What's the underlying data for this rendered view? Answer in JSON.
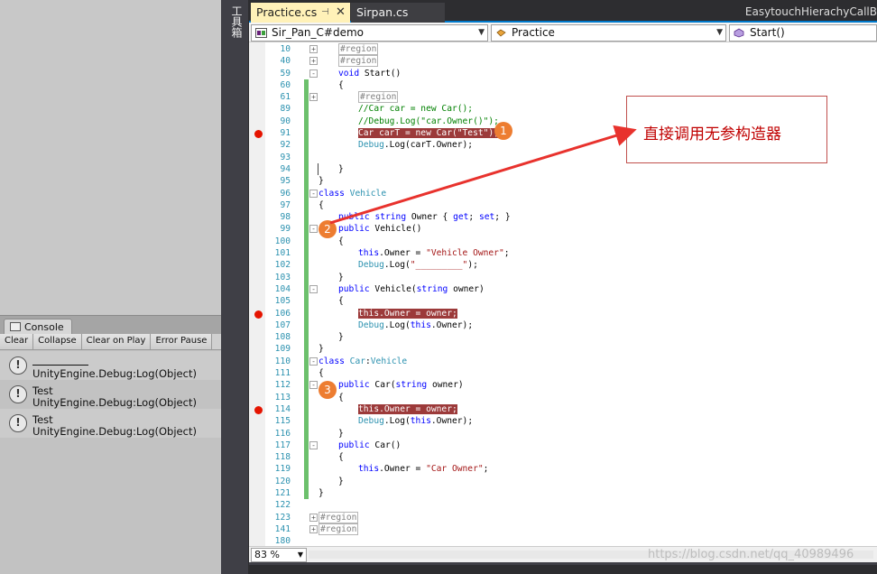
{
  "unity": {
    "console": {
      "tab_label": "Console",
      "toolbar": [
        "Clear",
        "Collapse",
        "Clear on Play",
        "Error Pause"
      ],
      "logs": [
        {
          "message": "",
          "source": "UnityEngine.Debug:Log(Object)",
          "underline": true
        },
        {
          "message": "Test",
          "source": "UnityEngine.Debug:Log(Object)",
          "underline": false
        },
        {
          "message": "Test",
          "source": "UnityEngine.Debug:Log(Object)",
          "underline": false
        }
      ]
    }
  },
  "toolbox": {
    "label": "工具箱"
  },
  "tabs": {
    "active": {
      "label": "Practice.cs",
      "pin": "⊣",
      "close": "✕"
    },
    "other": {
      "label": "Sirpan.cs"
    }
  },
  "window_title": "EasytouchHierachyCallB",
  "navbar": {
    "project": "Sir_Pan_C#demo",
    "class": "Practice",
    "method": "Start()"
  },
  "code": [
    {
      "n": "10",
      "indent": 2,
      "fold": "+",
      "chg": false,
      "tokens": [
        [
          "rg",
          "#region"
        ]
      ]
    },
    {
      "n": "40",
      "indent": 2,
      "fold": "+",
      "chg": false,
      "tokens": [
        [
          "rg",
          "#region"
        ]
      ]
    },
    {
      "n": "59",
      "indent": 2,
      "fold": "-",
      "chg": false,
      "tokens": [
        [
          "kw",
          "void"
        ],
        [
          "",
          " Start()"
        ]
      ]
    },
    {
      "n": "60",
      "indent": 2,
      "fold": "",
      "chg": true,
      "tokens": [
        [
          "",
          "{"
        ]
      ]
    },
    {
      "n": "61",
      "indent": 4,
      "fold": "+",
      "chg": true,
      "tokens": [
        [
          "rg",
          "#region"
        ]
      ]
    },
    {
      "n": "89",
      "indent": 4,
      "fold": "",
      "chg": true,
      "tokens": [
        [
          "cm",
          "//Car car = new Car();"
        ]
      ]
    },
    {
      "n": "90",
      "indent": 4,
      "fold": "",
      "chg": true,
      "tokens": [
        [
          "cm",
          "//Debug.Log(\"car.Owner()\");"
        ]
      ]
    },
    {
      "n": "91",
      "indent": 4,
      "fold": "",
      "chg": true,
      "bp": true,
      "tokens": [
        [
          "hl",
          "Car carT = new Car(\"Test\");"
        ]
      ]
    },
    {
      "n": "92",
      "indent": 4,
      "fold": "",
      "chg": true,
      "tokens": [
        [
          "ty",
          "Debug"
        ],
        [
          "",
          ".Log(carT.Owner);"
        ]
      ]
    },
    {
      "n": "93",
      "indent": 4,
      "fold": "",
      "chg": true,
      "tokens": []
    },
    {
      "n": "94",
      "indent": 2,
      "fold": "",
      "chg": true,
      "cursor": true,
      "tokens": [
        [
          "",
          "}"
        ]
      ]
    },
    {
      "n": "95",
      "indent": 0,
      "fold": "",
      "chg": true,
      "tokens": [
        [
          "",
          "}"
        ]
      ]
    },
    {
      "n": "96",
      "indent": 0,
      "fold": "-",
      "chg": true,
      "tokens": [
        [
          "kw",
          "class"
        ],
        [
          "",
          " "
        ],
        [
          "ty",
          "Vehicle"
        ]
      ]
    },
    {
      "n": "97",
      "indent": 0,
      "fold": "",
      "chg": true,
      "tokens": [
        [
          "",
          "{"
        ]
      ]
    },
    {
      "n": "98",
      "indent": 2,
      "fold": "",
      "chg": true,
      "tokens": [
        [
          "kw",
          "public"
        ],
        [
          "",
          " "
        ],
        [
          "kw",
          "string"
        ],
        [
          "",
          " Owner { "
        ],
        [
          "kw",
          "get"
        ],
        [
          "",
          "; "
        ],
        [
          "kw",
          "set"
        ],
        [
          "",
          "; }"
        ]
      ]
    },
    {
      "n": "99",
      "indent": 2,
      "fold": "-",
      "chg": true,
      "tokens": [
        [
          "kw",
          "public"
        ],
        [
          "",
          " Vehicle()"
        ]
      ]
    },
    {
      "n": "100",
      "indent": 2,
      "fold": "",
      "chg": true,
      "tokens": [
        [
          "",
          "{"
        ]
      ]
    },
    {
      "n": "101",
      "indent": 4,
      "fold": "",
      "chg": true,
      "tokens": [
        [
          "kw",
          "this"
        ],
        [
          "",
          ".Owner = "
        ],
        [
          "st",
          "\"Vehicle Owner\""
        ],
        [
          "",
          ";"
        ]
      ]
    },
    {
      "n": "102",
      "indent": 4,
      "fold": "",
      "chg": true,
      "tokens": [
        [
          "ty",
          "Debug"
        ],
        [
          "",
          ".Log("
        ],
        [
          "st",
          "\"_________\""
        ],
        [
          "",
          ");"
        ]
      ]
    },
    {
      "n": "103",
      "indent": 2,
      "fold": "",
      "chg": true,
      "tokens": [
        [
          "",
          "}"
        ]
      ]
    },
    {
      "n": "104",
      "indent": 2,
      "fold": "-",
      "chg": true,
      "tokens": [
        [
          "kw",
          "public"
        ],
        [
          "",
          " Vehicle("
        ],
        [
          "kw",
          "string"
        ],
        [
          "",
          " owner)"
        ]
      ]
    },
    {
      "n": "105",
      "indent": 2,
      "fold": "",
      "chg": true,
      "tokens": [
        [
          "",
          "{"
        ]
      ]
    },
    {
      "n": "106",
      "indent": 4,
      "fold": "",
      "chg": true,
      "bp": true,
      "tokens": [
        [
          "hl",
          "this.Owner = owner;"
        ]
      ]
    },
    {
      "n": "107",
      "indent": 4,
      "fold": "",
      "chg": true,
      "tokens": [
        [
          "ty",
          "Debug"
        ],
        [
          "",
          ".Log("
        ],
        [
          "kw",
          "this"
        ],
        [
          "",
          ".Owner);"
        ]
      ]
    },
    {
      "n": "108",
      "indent": 2,
      "fold": "",
      "chg": true,
      "tokens": [
        [
          "",
          "}"
        ]
      ]
    },
    {
      "n": "109",
      "indent": 0,
      "fold": "",
      "chg": true,
      "tokens": [
        [
          "",
          "}"
        ]
      ]
    },
    {
      "n": "110",
      "indent": 0,
      "fold": "-",
      "chg": true,
      "tokens": [
        [
          "kw",
          "class"
        ],
        [
          "",
          " "
        ],
        [
          "ty",
          "Car"
        ],
        [
          "",
          ":"
        ],
        [
          "ty",
          "Vehicle"
        ]
      ]
    },
    {
      "n": "111",
      "indent": 0,
      "fold": "",
      "chg": true,
      "tokens": [
        [
          "",
          "{"
        ]
      ]
    },
    {
      "n": "112",
      "indent": 2,
      "fold": "-",
      "chg": true,
      "tokens": [
        [
          "kw",
          "public"
        ],
        [
          "",
          " Car("
        ],
        [
          "kw",
          "string"
        ],
        [
          "",
          " owner)"
        ]
      ]
    },
    {
      "n": "113",
      "indent": 2,
      "fold": "",
      "chg": true,
      "tokens": [
        [
          "",
          "{"
        ]
      ]
    },
    {
      "n": "114",
      "indent": 4,
      "fold": "",
      "chg": true,
      "bp": true,
      "tokens": [
        [
          "hl",
          "this.Owner = owner;"
        ]
      ]
    },
    {
      "n": "115",
      "indent": 4,
      "fold": "",
      "chg": true,
      "tokens": [
        [
          "ty",
          "Debug"
        ],
        [
          "",
          ".Log("
        ],
        [
          "kw",
          "this"
        ],
        [
          "",
          ".Owner);"
        ]
      ]
    },
    {
      "n": "116",
      "indent": 2,
      "fold": "",
      "chg": true,
      "tokens": [
        [
          "",
          "}"
        ]
      ]
    },
    {
      "n": "117",
      "indent": 2,
      "fold": "-",
      "chg": true,
      "tokens": [
        [
          "kw",
          "public"
        ],
        [
          "",
          " Car()"
        ]
      ]
    },
    {
      "n": "118",
      "indent": 2,
      "fold": "",
      "chg": true,
      "tokens": [
        [
          "",
          "{"
        ]
      ]
    },
    {
      "n": "119",
      "indent": 4,
      "fold": "",
      "chg": true,
      "tokens": [
        [
          "kw",
          "this"
        ],
        [
          "",
          ".Owner = "
        ],
        [
          "st",
          "\"Car Owner\""
        ],
        [
          "",
          ";"
        ]
      ]
    },
    {
      "n": "120",
      "indent": 2,
      "fold": "",
      "chg": true,
      "tokens": [
        [
          "",
          "}"
        ]
      ]
    },
    {
      "n": "121",
      "indent": 0,
      "fold": "",
      "chg": true,
      "tokens": [
        [
          "",
          "}"
        ]
      ]
    },
    {
      "n": "122",
      "indent": 0,
      "fold": "",
      "chg": false,
      "tokens": []
    },
    {
      "n": "123",
      "indent": 0,
      "fold": "+",
      "chg": false,
      "tokens": [
        [
          "rg",
          "#region"
        ]
      ]
    },
    {
      "n": "141",
      "indent": 0,
      "fold": "+",
      "chg": false,
      "tokens": [
        [
          "rg",
          "#region"
        ]
      ]
    },
    {
      "n": "180",
      "indent": 0,
      "fold": "",
      "chg": false,
      "tokens": []
    }
  ],
  "annotation": {
    "text": "直接调用无参构造器",
    "badges": [
      "1",
      "2",
      "3"
    ]
  },
  "zoom": "83 %",
  "watermark": "https://blog.csdn.net/qq_40989496",
  "colors": {
    "keyword": "#0000ff",
    "type": "#2b91af",
    "comment": "#008000",
    "string": "#a31515",
    "breakpoint": "#e51400",
    "highlight": "#9c3a3a",
    "annotation": "#c00000",
    "badge": "#ed7d31"
  }
}
